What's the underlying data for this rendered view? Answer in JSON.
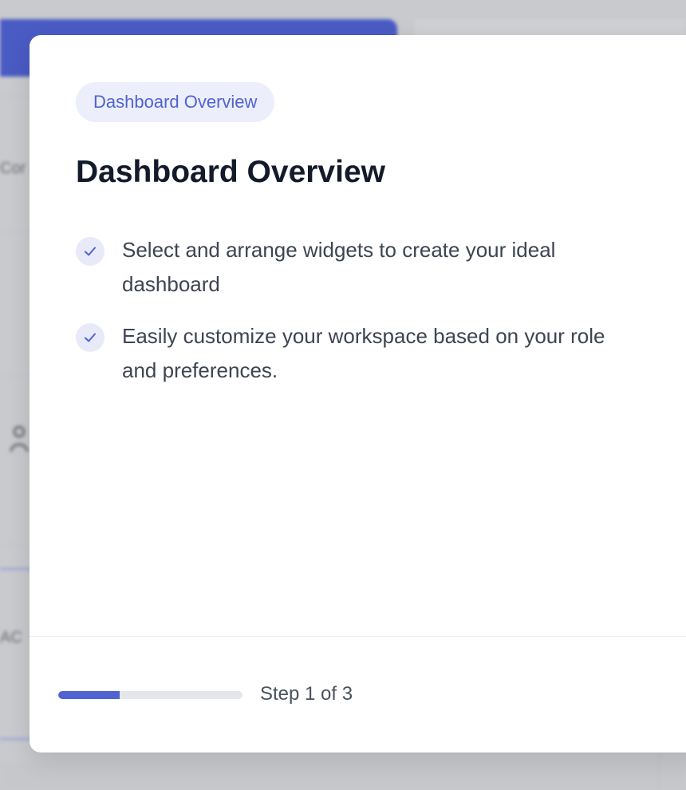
{
  "background": {
    "text_fragment_1": "Cor",
    "text_fragment_2": "AC"
  },
  "onboarding": {
    "badge": "Dashboard Overview",
    "title": "Dashboard Overview",
    "features": [
      "Select and arrange widgets to create your ideal dashboard",
      "Easily customize your workspace based on your role and preferences."
    ],
    "step_label": "Step 1 of 3",
    "progress_fraction": 0.333
  },
  "colors": {
    "accent": "#4f63d2",
    "badge_bg": "#eceefb",
    "title": "#131a2a",
    "overlay": "#c9cacd"
  },
  "icons": {
    "feature_check": "check-icon"
  }
}
